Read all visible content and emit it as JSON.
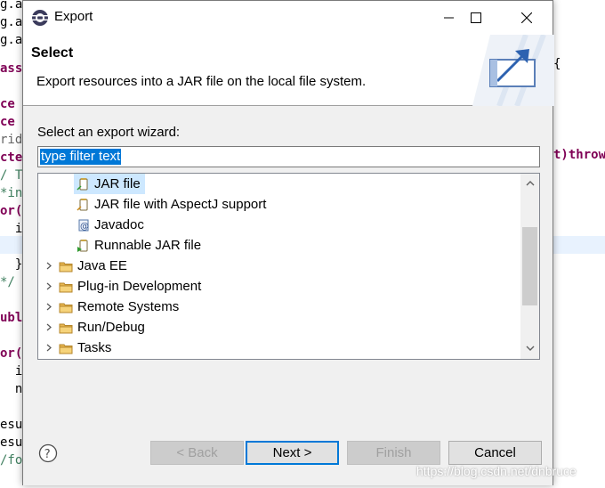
{
  "editor": {
    "left_fragments": [
      "g.ap",
      "g.ap",
      "g.ap",
      "ass",
      "ce D",
      "ce D",
      "ride",
      "cted",
      "/ TO",
      "*int",
      "or(I",
      "  i",
      "  }",
      "*/",
      "ubl",
      "or(I",
      "  i",
      "  n",
      "esul",
      "esul",
      "/for"
    ],
    "right_fragments": [
      "{",
      "t)throw"
    ]
  },
  "dialog": {
    "title": "Export",
    "banner_title": "Select",
    "banner_description": "Export resources into a JAR file on the local file system.",
    "wizard_label": "Select an export wizard:",
    "filter_value": "type filter text",
    "tree_items": [
      {
        "label": "JAR file",
        "icon": "jar-icon",
        "indent": 1,
        "selected": true
      },
      {
        "label": "JAR file with AspectJ support",
        "icon": "aspectj-jar-icon",
        "indent": 1
      },
      {
        "label": "Javadoc",
        "icon": "javadoc-icon",
        "indent": 1
      },
      {
        "label": "Runnable JAR file",
        "icon": "runnable-jar-icon",
        "indent": 1
      },
      {
        "label": "Java EE",
        "icon": "folder-icon",
        "indent": 0
      },
      {
        "label": "Plug-in Development",
        "icon": "folder-icon",
        "indent": 0
      },
      {
        "label": "Remote Systems",
        "icon": "folder-icon",
        "indent": 0
      },
      {
        "label": "Run/Debug",
        "icon": "folder-icon",
        "indent": 0
      },
      {
        "label": "Tasks",
        "icon": "folder-icon",
        "indent": 0
      }
    ],
    "buttons": {
      "back": "< Back",
      "next": "Next >",
      "finish": "Finish",
      "cancel": "Cancel"
    }
  },
  "watermark": "https://blog.csdn.net/dnbruce",
  "colors": {
    "selection": "#0078d7",
    "tree_selection": "#cde8ff",
    "keyword": "#7f0055"
  }
}
